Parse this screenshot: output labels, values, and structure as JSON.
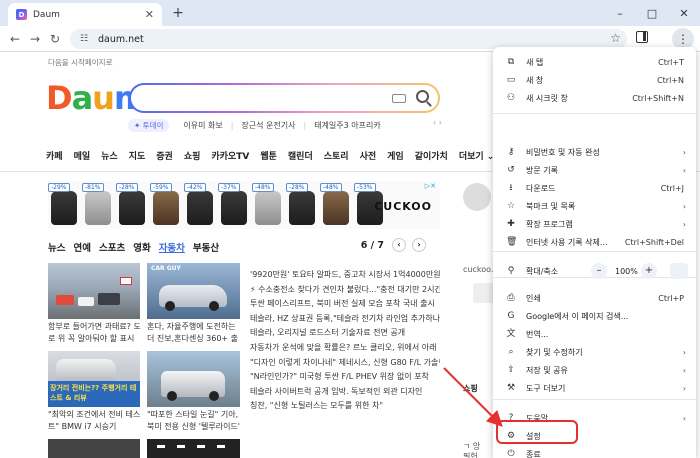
{
  "browser": {
    "tab_title": "Daum",
    "tab_favicon": "D",
    "new_tab": "+",
    "url": "daum.net",
    "win_minimize": "–",
    "win_maximize": "□",
    "win_close": "✕"
  },
  "page": {
    "start_text": "다음을 시작페이지로",
    "logo": [
      "D",
      "a",
      "u",
      "m"
    ],
    "logo_colors": [
      "#f05a2a",
      "#2fb14a",
      "#f0a21c",
      "#3d7cf0"
    ],
    "trend_tag": "✦ 투데이",
    "trends": [
      "이유미 화보",
      "장근석 운전기사",
      "태계일주3 아프리카"
    ],
    "services": [
      "카페",
      "메일",
      "뉴스",
      "지도",
      "증권",
      "쇼핑",
      "카카오TV",
      "웹툰",
      "캘린더",
      "스토리",
      "사전",
      "게임",
      "같이가치",
      "더보기 ⌄"
    ],
    "ad": {
      "discounts": [
        "-29%",
        "-81%",
        "-28%",
        "-59%",
        "-42%",
        "-37%",
        "-48%",
        "-28%",
        "-48%",
        "-53%"
      ],
      "brand": "CUCKOO",
      "close": "▷✕"
    },
    "news_tabs": [
      "뉴스",
      "연예",
      "스포츠",
      "영화",
      "자동차",
      "부동산"
    ],
    "news_active": "자동차",
    "pager": "6 / 7",
    "captions": [
      "함부로 들어가면 과태료? 도로 위 꼭 알아둬야 할 표시 이",
      "혼다, 자율주행에 도전하는 더 진보,혼다센싱 360+ 출시",
      "\"최악의 조건에서 전비 테스트\" BMW i7 시승기",
      "\"따포한 스타일 눈길\" 기아, 북미 전용 신형 '텔루라이드'"
    ],
    "thumb_overlay": "장거리 전비는?? 주행거리 테스트 & 리뷰",
    "thumb_label": "CAR GUY",
    "headlines": [
      "'9920만원' 토요타 알파드, 중고차 시장서 1억4000만원대",
      "⚡ 수소충전소 찾다가 견인차 불렀다...\"충전 대기만 2시간\"",
      "투싼 페이스리프트, 북미 버전 실제 모습 포착 국내 출시",
      "테슬라, HZ 상표권 등록,\"테슬라 전기차 라인업 추가하나",
      "테슬라, 오리지널 로드스터 기술자료 전면 공개",
      "자동차가 운석에 맞을 확률은? 르노 클리오, 위에서 아래",
      "\"디자인 이렇게 차이나네\" 제네시스, 신형 G80 F/L 가솔린",
      "\"N라인인가?\" 미국형 투싼 F/L PHEV 위장 없이 포착",
      "테슬라 사이버트럭 공개 임박. 독보적인 외관 디자인",
      "칭찬, \"신형 노틸러스는 모두를 위한 차\""
    ],
    "right_panel": [
      "cuckoo.c",
      "쇼핑",
      "ㄱ 앙",
      "필헌"
    ]
  },
  "menu": {
    "items": [
      {
        "icon": "new-tab-icon",
        "glyph": "⧉",
        "label": "새 탭",
        "shortcut": "Ctrl+T",
        "arrow": ""
      },
      {
        "icon": "new-window-icon",
        "glyph": "▭",
        "label": "새 창",
        "shortcut": "Ctrl+N",
        "arrow": ""
      },
      {
        "icon": "incognito-icon",
        "glyph": "⚇",
        "label": "새 시크릿 창",
        "shortcut": "Ctrl+Shift+N",
        "arrow": ""
      },
      {
        "icon": "password-key-icon",
        "glyph": "⚷",
        "label": "비밀번호 및 자동 완성",
        "shortcut": "",
        "arrow": "›"
      },
      {
        "icon": "history-icon",
        "glyph": "↺",
        "label": "방문 기록",
        "shortcut": "",
        "arrow": "›"
      },
      {
        "icon": "download-icon",
        "glyph": "⭳",
        "label": "다운로드",
        "shortcut": "Ctrl+J",
        "arrow": ""
      },
      {
        "icon": "bookmark-star-icon",
        "glyph": "☆",
        "label": "북마크 및 목록",
        "shortcut": "",
        "arrow": "›"
      },
      {
        "icon": "extension-icon",
        "glyph": "✚",
        "label": "확장 프로그램",
        "shortcut": "",
        "arrow": "›"
      },
      {
        "icon": "trash-icon",
        "glyph": "🗑",
        "label": "인터넷 사용 기록 삭제...",
        "shortcut": "Ctrl+Shift+Del",
        "arrow": ""
      },
      {
        "icon": "print-icon",
        "glyph": "⎙",
        "label": "인쇄",
        "shortcut": "Ctrl+P",
        "arrow": ""
      },
      {
        "icon": "google-icon",
        "glyph": "G",
        "label": "Google에서 이 페이지 검색...",
        "shortcut": "",
        "arrow": ""
      },
      {
        "icon": "translate-icon",
        "glyph": "文",
        "label": "번역...",
        "shortcut": "",
        "arrow": ""
      },
      {
        "icon": "find-icon",
        "glyph": "⌕",
        "label": "찾기 및 수정하기",
        "shortcut": "",
        "arrow": "›"
      },
      {
        "icon": "save-share-icon",
        "glyph": "⇪",
        "label": "저장 및 공유",
        "shortcut": "",
        "arrow": "›"
      },
      {
        "icon": "tools-icon",
        "glyph": "⚒",
        "label": "도구 더보기",
        "shortcut": "",
        "arrow": "›"
      },
      {
        "icon": "help-icon",
        "glyph": "?",
        "label": "도움말",
        "shortcut": "",
        "arrow": "›"
      },
      {
        "icon": "settings-gear-icon",
        "glyph": "⚙",
        "label": "설정",
        "shortcut": "",
        "arrow": ""
      },
      {
        "icon": "exit-icon",
        "glyph": "⏻",
        "label": "종료",
        "shortcut": "",
        "arrow": ""
      }
    ],
    "zoom": {
      "label": "확대/축소",
      "minus": "–",
      "value": "100%",
      "plus": "+"
    }
  },
  "colors": {
    "annotation": "#e53030",
    "tab_active": "#3a6de0"
  }
}
